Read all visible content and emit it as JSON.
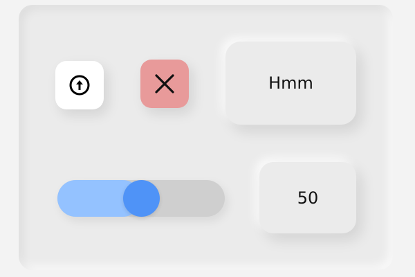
{
  "buttons": {
    "upload": {
      "icon": "upload-circle-icon"
    },
    "close": {
      "icon": "close-icon",
      "color": "#e89a9a"
    },
    "hmm": {
      "label": "Hmm"
    }
  },
  "slider": {
    "value": 50,
    "min": 0,
    "max": 100,
    "fill_color": "#94c2ff",
    "knob_color": "#4f93f7"
  },
  "value_display": "50"
}
